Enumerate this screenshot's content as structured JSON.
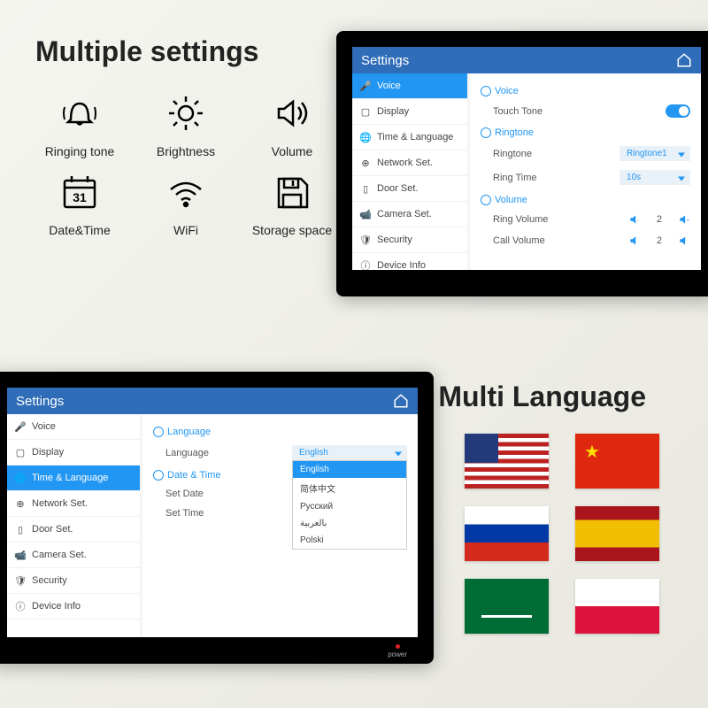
{
  "titles": {
    "settings": "Multiple settings",
    "language": "Multi Language"
  },
  "features": [
    {
      "label": "Ringing tone"
    },
    {
      "label": "Brightness"
    },
    {
      "label": "Volume"
    },
    {
      "label": "Date&Time"
    },
    {
      "label": "WiFi"
    },
    {
      "label": "Storage space"
    }
  ],
  "screen1": {
    "header": "Settings",
    "sidebar": [
      "Voice",
      "Display",
      "Time & Language",
      "Network Set.",
      "Door Set.",
      "Camera Set.",
      "Security",
      "Device Info"
    ],
    "content": {
      "voice_section": "Voice",
      "touch_tone": "Touch Tone",
      "ringtone_section": "Ringtone",
      "ringtone_label": "Ringtone",
      "ringtone_value": "Ringtone1",
      "ring_time_label": "Ring Time",
      "ring_time_value": "10s",
      "volume_section": "Volume",
      "ring_volume_label": "Ring Volume",
      "ring_volume_value": "2",
      "call_volume_label": "Call Volume",
      "call_volume_value": "2"
    }
  },
  "screen2": {
    "header": "Settings",
    "sidebar": [
      "Voice",
      "Display",
      "Time & Language",
      "Network Set.",
      "Door Set.",
      "Camera Set.",
      "Security",
      "Device Info"
    ],
    "content": {
      "language_section": "Language",
      "language_label": "Language",
      "language_value": "English",
      "options": [
        "English",
        "简体中文",
        "Русский",
        "بالعربية",
        "Polski"
      ],
      "date_time_section": "Date & Time",
      "set_date": "Set Date",
      "set_time": "Set Time"
    },
    "power": "power"
  },
  "flags": [
    "us",
    "cn",
    "ru",
    "es",
    "sa",
    "pl"
  ]
}
